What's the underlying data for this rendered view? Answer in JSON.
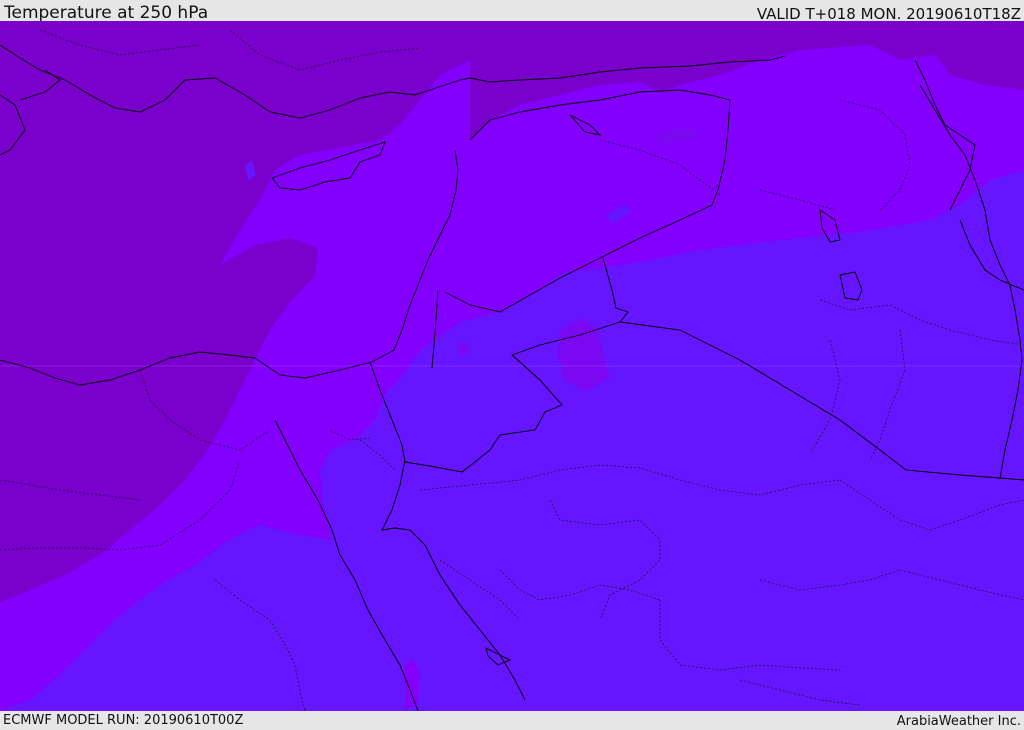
{
  "header": {
    "title": "Temperature at 250 hPa",
    "valid": "VALID T+018 MON. 20190610T18Z"
  },
  "footer": {
    "model_run": "ECMWF MODEL RUN: 20190610T00Z",
    "credit": "ArabiaWeather Inc."
  },
  "map": {
    "region": "Eastern Mediterranean / Middle East",
    "field": "temperature",
    "level": "250 hPa",
    "colors": {
      "coldest": "#7a00cc",
      "cold": "#8300ff",
      "mild": "#6616ff",
      "accent_patch": "#7a08f0",
      "coastline": "#000000",
      "border": "#000000"
    }
  }
}
